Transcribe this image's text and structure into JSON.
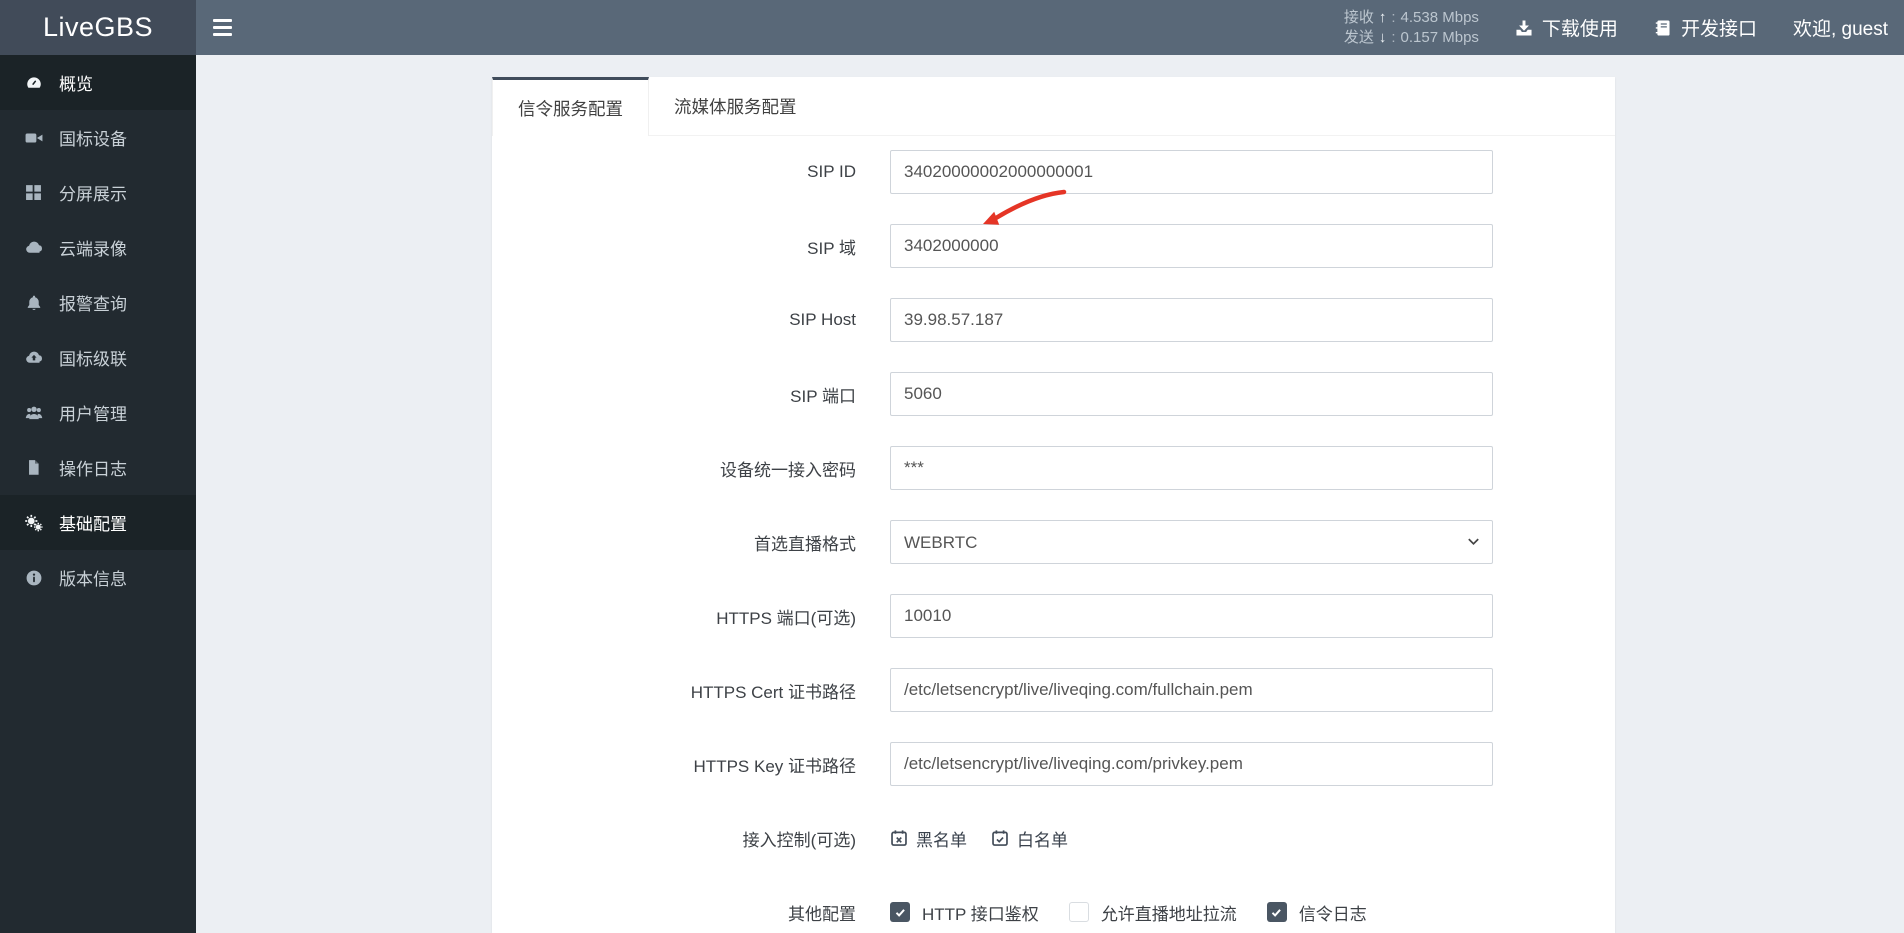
{
  "header": {
    "logo": "LiveGBS",
    "stats": {
      "rx_label": "接收",
      "rx_sep": ":",
      "rx_value": "4.538 Mbps",
      "tx_label": "发送",
      "tx_sep": ":",
      "tx_value": "0.157 Mbps"
    },
    "download_label": "下载使用",
    "api_label": "开发接口",
    "welcome": "欢迎, guest"
  },
  "sidebar": {
    "items": [
      {
        "label": "概览",
        "icon": "dashboard-icon",
        "active": true
      },
      {
        "label": "国标设备",
        "icon": "camera-icon"
      },
      {
        "label": "分屏展示",
        "icon": "grid-icon"
      },
      {
        "label": "云端录像",
        "icon": "cloud-icon"
      },
      {
        "label": "报警查询",
        "icon": "bell-icon"
      },
      {
        "label": "国标级联",
        "icon": "cloud-upload-icon"
      },
      {
        "label": "用户管理",
        "icon": "users-icon"
      },
      {
        "label": "操作日志",
        "icon": "file-icon"
      },
      {
        "label": "基础配置",
        "icon": "gears-icon",
        "current": true
      },
      {
        "label": "版本信息",
        "icon": "info-icon"
      }
    ]
  },
  "tabs": [
    {
      "label": "信令服务配置",
      "active": true
    },
    {
      "label": "流媒体服务配置",
      "active": false
    }
  ],
  "form": {
    "fields": [
      {
        "label": "SIP ID",
        "value": "34020000002000000001",
        "type": "text"
      },
      {
        "label": "SIP 域",
        "value": "3402000000",
        "type": "text",
        "annotated": "red-arrow"
      },
      {
        "label": "SIP Host",
        "value": "39.98.57.187",
        "type": "text"
      },
      {
        "label": "SIP 端口",
        "value": "5060",
        "type": "text"
      },
      {
        "label": "设备统一接入密码",
        "value": "***",
        "type": "text"
      },
      {
        "label": "首选直播格式",
        "value": "WEBRTC",
        "type": "select"
      },
      {
        "label": "HTTPS 端口(可选)",
        "value": "10010",
        "type": "text"
      },
      {
        "label": "HTTPS Cert 证书路径",
        "value": "/etc/letsencrypt/live/liveqing.com/fullchain.pem",
        "type": "text"
      },
      {
        "label": "HTTPS Key 证书路径",
        "value": "/etc/letsencrypt/live/liveqing.com/privkey.pem",
        "type": "text"
      },
      {
        "label": "接入控制(可选)",
        "type": "links",
        "links": [
          {
            "label": "黑名单",
            "icon": "calendar-x-icon"
          },
          {
            "label": "白名单",
            "icon": "calendar-check-icon"
          }
        ]
      },
      {
        "label": "其他配置",
        "type": "checkboxes",
        "checkboxes": [
          {
            "label": "HTTP 接口鉴权",
            "checked": true
          },
          {
            "label": "允许直播地址拉流",
            "checked": false
          },
          {
            "label": "信令日志",
            "checked": true
          }
        ]
      }
    ]
  },
  "colors": {
    "navbar": "#596878",
    "logo_bg": "#414b59",
    "sidebar_bg": "#222a30",
    "sidebar_active_bg": "#1b2327",
    "tab_accent": "#404c5b",
    "checkbox_checked": "#4a5663",
    "annotation_arrow": "#e53526",
    "content_bg": "#eceff3"
  }
}
